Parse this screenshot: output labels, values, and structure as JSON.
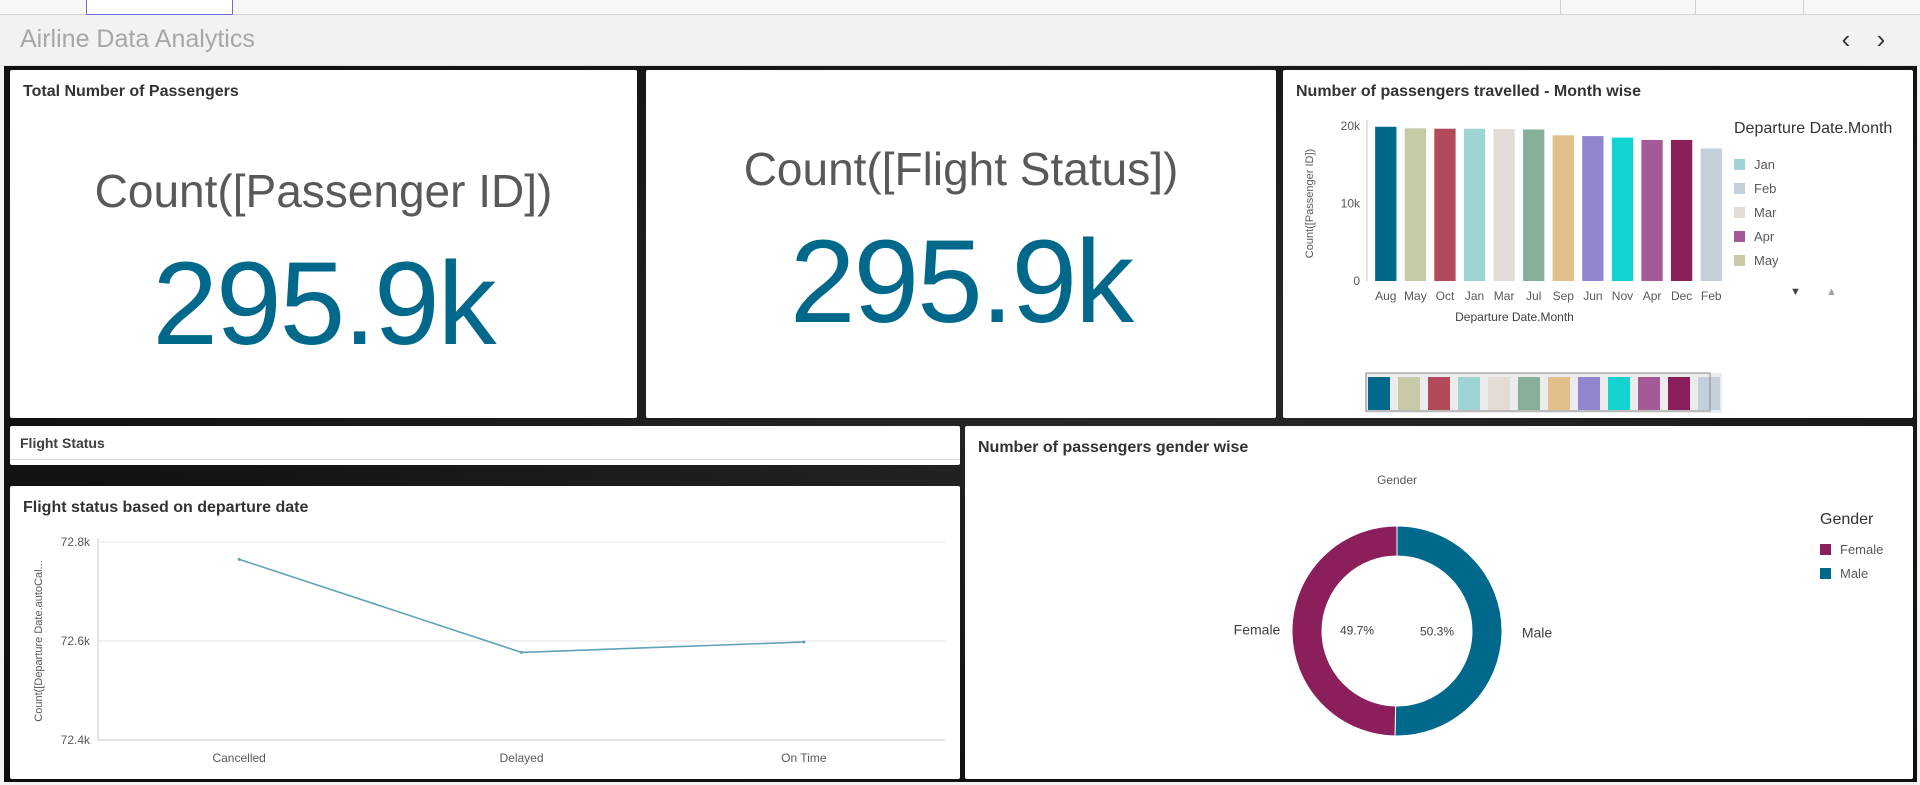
{
  "app": {
    "title": "Airline Data Analytics",
    "prev_icon": "chevron-left-icon",
    "next_icon": "chevron-right-icon"
  },
  "kpi_passengers": {
    "title": "Total Number of Passengers",
    "label": "Count([Passenger ID])",
    "value": "295.9k"
  },
  "kpi_flight_status": {
    "label": "Count([Flight Status])",
    "value": "295.9k"
  },
  "monthly_chart": {
    "title": "Number of passengers travelled - Month wise",
    "legend_title": "Departure Date.Month",
    "legend_items": [
      {
        "label": "Jan",
        "color": "#9fd4d4"
      },
      {
        "label": "Feb",
        "color": "#c3cfdb"
      },
      {
        "label": "Mar",
        "color": "#e3dcd5"
      },
      {
        "label": "Apr",
        "color": "#a45a96"
      },
      {
        "label": "May",
        "color": "#c7c9a7"
      }
    ]
  },
  "flight_status_filter": {
    "title": "Flight Status"
  },
  "line_chart_panel": {
    "title": "Flight status based on departure date"
  },
  "gender_chart_panel": {
    "title": "Number of passengers gender wise",
    "legend_title": "Gender",
    "legend_items": [
      {
        "label": "Female",
        "color": "#8a1f5b"
      },
      {
        "label": "Male",
        "color": "#00688a"
      }
    ]
  },
  "chart_data": [
    {
      "type": "bar",
      "title": "Number of passengers travelled - Month wise",
      "xlabel": "Departure Date.Month",
      "ylabel": "Count([Passenger ID])",
      "categories": [
        "Aug",
        "May",
        "Oct",
        "Jan",
        "Mar",
        "Jul",
        "Sep",
        "Jun",
        "Nov",
        "Apr",
        "Dec",
        "Feb"
      ],
      "values": [
        19900,
        19700,
        19650,
        19650,
        19600,
        19550,
        18800,
        18700,
        18500,
        18200,
        18200,
        17100
      ],
      "colors": [
        "#00688a",
        "#c7c9a7",
        "#b24a5c",
        "#9fd4d4",
        "#e3dcd5",
        "#86ae98",
        "#e2bf8b",
        "#8f86cf",
        "#12d3cf",
        "#a45a96",
        "#8a1f5b",
        "#c3cfdb"
      ],
      "yticks": [
        "0",
        "10k",
        "20k"
      ],
      "ylim": [
        0,
        20000
      ],
      "legend": "right"
    },
    {
      "type": "line",
      "title": "Flight status based on departure date",
      "xlabel": "",
      "ylabel": "Count([Departure Date.autoCal...",
      "categories": [
        "Cancelled",
        "Delayed",
        "On Time"
      ],
      "values": [
        72765,
        72577,
        72598
      ],
      "yticks": [
        "72.4k",
        "72.6k",
        "72.8k"
      ],
      "ylim": [
        72400,
        72800
      ],
      "color": "#5ea3b5",
      "grid": true
    },
    {
      "type": "pie",
      "title": "Gender",
      "categories": [
        "Female",
        "Male"
      ],
      "values": [
        49.7,
        50.3
      ],
      "value_labels": [
        "49.7%",
        "50.3%"
      ],
      "colors": [
        "#8a1f5b",
        "#00688a"
      ],
      "donut": true,
      "legend": "right"
    }
  ]
}
